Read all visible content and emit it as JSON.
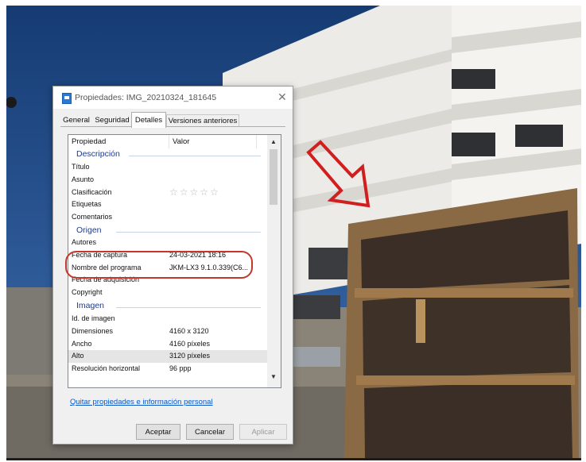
{
  "dialog": {
    "title": "Propiedades: IMG_20210324_181645",
    "close_glyph": "✕",
    "file_icon": "image-file-icon"
  },
  "tabs": [
    {
      "label": "General"
    },
    {
      "label": "Seguridad"
    },
    {
      "label": "Detalles"
    },
    {
      "label": "Versiones anteriores"
    }
  ],
  "active_tab": "Detalles",
  "table": {
    "col_property": "Propiedad",
    "col_value": "Valor",
    "groups": [
      {
        "label": "Descripción"
      },
      {
        "label": "Origen"
      },
      {
        "label": "Imagen"
      }
    ],
    "rows": [
      {
        "p": "Título",
        "v": ""
      },
      {
        "p": "Asunto",
        "v": ""
      },
      {
        "p": "Clasificación",
        "v": "☆☆☆☆☆"
      },
      {
        "p": "Etiquetas",
        "v": ""
      },
      {
        "p": "Comentarios",
        "v": ""
      },
      {
        "p": "Autores",
        "v": ""
      },
      {
        "p": "Fecha de captura",
        "v": "24-03-2021 18:16"
      },
      {
        "p": "Nombre del programa",
        "v": "JKM-LX3 9.1.0.339(C6..."
      },
      {
        "p": "Fecha de adquisición",
        "v": ""
      },
      {
        "p": "Copyright",
        "v": ""
      },
      {
        "p": "Id. de imagen",
        "v": ""
      },
      {
        "p": "Dimensiones",
        "v": "4160 x 3120"
      },
      {
        "p": "Ancho",
        "v": "4160 píxeles"
      },
      {
        "p": "Alto",
        "v": "3120 píxeles"
      },
      {
        "p": "Resolución horizontal",
        "v": "96 ppp"
      }
    ]
  },
  "remove_link": "Quitar propiedades e información personal",
  "buttons": {
    "accept": "Aceptar",
    "cancel": "Cancelar",
    "apply": "Aplicar"
  },
  "scroll_glyphs": {
    "up": "▲",
    "down": "▼"
  },
  "colors": {
    "annotation_red": "#c0392b",
    "link_blue": "#0a57c7",
    "group_blue": "#1e3b8a",
    "sky": "#2f5f9c"
  }
}
